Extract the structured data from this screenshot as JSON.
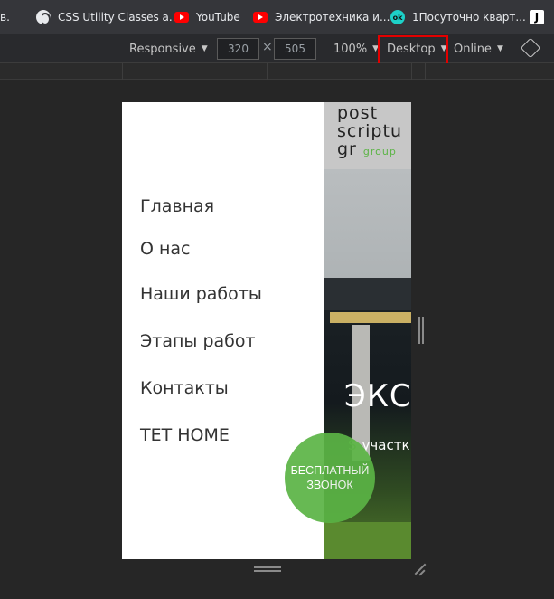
{
  "bookmarks": [
    {
      "label": "в.",
      "icon": "none"
    },
    {
      "label": "CSS Utility Classes a...",
      "icon": "globe-icon"
    },
    {
      "label": "YouTube",
      "icon": "youtube-icon"
    },
    {
      "label": "Электротехника и...",
      "icon": "youtube-icon"
    },
    {
      "label": "1Посуточно кварт...",
      "icon": "ok-icon"
    },
    {
      "label": "J",
      "icon": "j-icon"
    }
  ],
  "device_toolbar": {
    "mode": "Responsive",
    "width": "320",
    "height": "505",
    "times": "×",
    "zoom": "100%",
    "device_type": "Desktop",
    "throttle": "Online"
  },
  "page": {
    "logo_lines": [
      "post",
      "scriptu",
      "gr"
    ],
    "logo_green": "group",
    "menu_items": [
      "Главная",
      "О нас",
      "Наши работы",
      "Этапы работ",
      "Контакты",
      "TET HOME"
    ],
    "hero_title": "ЭКСП",
    "hero_sub_mark": "S",
    "hero_sub": "участк",
    "call_button_lines": [
      "БЕСПЛАТНЫЙ",
      "ЗВОНОК"
    ]
  },
  "colors": {
    "brand_green": "#5bb445",
    "highlight_red": "#e30000"
  }
}
